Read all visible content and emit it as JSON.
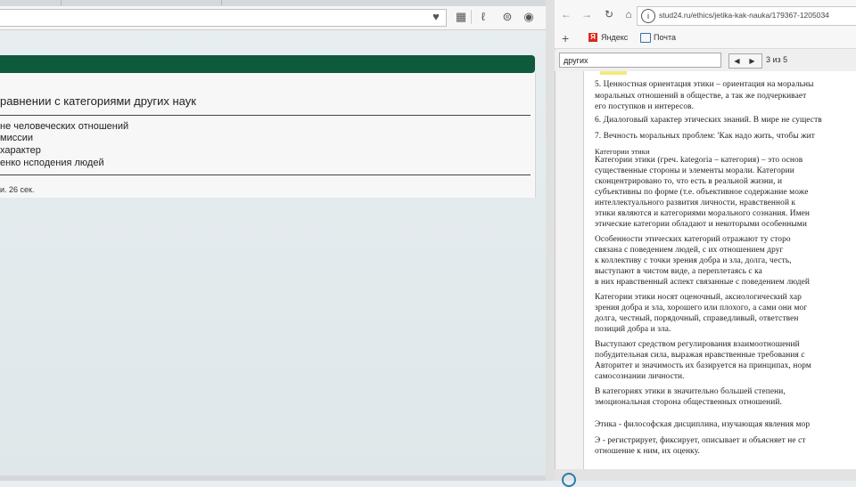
{
  "left_window": {
    "page": {
      "heading": "равнении с категориями других наук",
      "items": [
        "не человеческих отношений",
        "миссии",
        "характер",
        "енко нсподения людей"
      ],
      "note": "и. 26 сек."
    }
  },
  "right_window": {
    "address": {
      "url": "stud24.ru/ethics/jetika-kak-nauka/179367-1205034"
    },
    "bookmarks": [
      {
        "label": "Яндекс",
        "icon": "yandex-icon"
      },
      {
        "label": "Почта",
        "icon": "mail-icon"
      }
    ],
    "find_bar": {
      "query": "других",
      "count": "3 из 5"
    },
    "document_lines": [
      "5. Ценностная ориентация этики – ориентация на моральны",
      "    моральных отношений в обществе, а так же подчеркивает",
      "    его поступков и интересов.",
      "6. Диалоговый характер этических знаний. В мире не существ",
      "7. Вечность моральных проблем: 'Как надо жить, чтобы жит",
      "Категории этики",
      "Категории этики (греч. kategoria – категория) – это основ",
      "существенные стороны и элементы морали. Категории",
      "сконцентрировано то, что есть в реальной жизни, и",
      "субъективны по форме (т.е. объективное содержание може",
      "интеллектуального развития личности, нравственной к",
      "этики являются и категориями морального сознания. Имен",
      "этические категории обладают и некоторыми особенными",
      "Особенности этических категорий отражают ту сторо",
      "связана с поведением людей, с их отношением друг",
      "к коллективу с точки зрения добра и зла, долга, честь,",
      "выступают в чистом виде, а переплетаясь с ка",
      "в них нравственный аспект связанные с поведением людей",
      "Категории этики носят оценочный, аксиологический хар",
      "зрения добра и зла, хорошего или плохого, а сами они мог",
      "долга, честный, порядочный, справедливый, ответствен",
      "позиций добра и зла.",
      "Выступают средством регулирования взаимоотношений",
      "побудительная сила, выражая нравственные требования с",
      "Авторитет и значимость их базируется на принципах, норм",
      "самосознании личности.",
      "В категориях этики в значительно большей степени,",
      "эмоциональная сторона общественных отношений.",
      "Этика - философская дисциплина, изучающая явления мор",
      "Э - регистрирует, фиксирует, описывает и объясняет не ст",
      "отношение к ним, их оценку."
    ]
  },
  "colors": {
    "accent_green": "#0f5a3c",
    "find_highlight": "#f3ea7a"
  }
}
